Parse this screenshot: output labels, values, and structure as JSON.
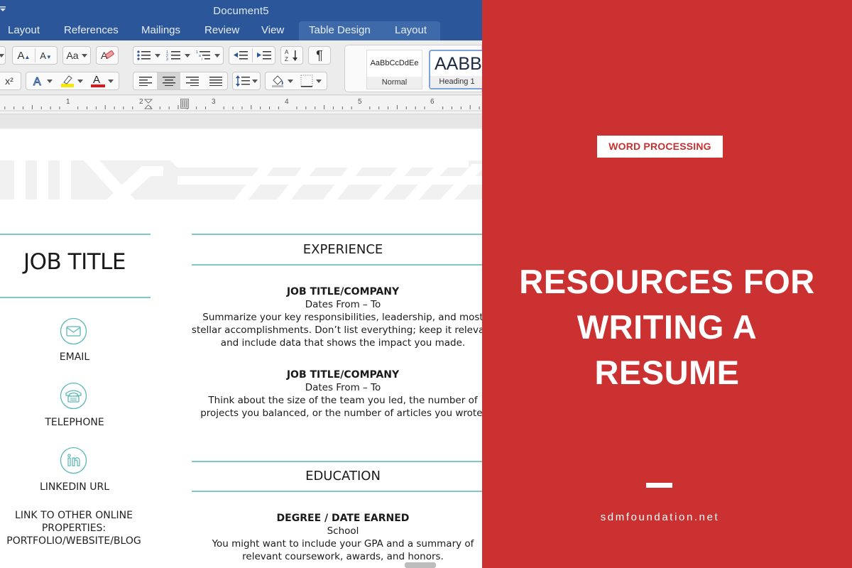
{
  "word": {
    "document_title": "Document5",
    "tabs": [
      "Layout",
      "References",
      "Mailings",
      "Review",
      "View",
      "Table Design",
      "Layout"
    ],
    "ribbon": {
      "superscript_label": "x²",
      "styles": [
        {
          "preview": "AaBbCcDdEe",
          "label": "Normal"
        },
        {
          "preview": "AABBC",
          "label": "Heading 1"
        }
      ]
    },
    "ruler_numbers": [
      "1",
      "2",
      "3",
      "4",
      "5",
      "6"
    ],
    "resume": {
      "job_title": "JOB TITLE",
      "contacts": [
        {
          "icon": "envelope-icon",
          "label": "EMAIL"
        },
        {
          "icon": "telephone-icon",
          "label": "TELEPHONE"
        },
        {
          "icon": "linkedin-icon",
          "label": "LINKEDIN URL"
        }
      ],
      "other_links": "LINK TO OTHER ONLINE PROPERTIES: PORTFOLIO/WEBSITE/BLOG",
      "experience_heading": "EXPERIENCE",
      "experience": [
        {
          "title": "JOB TITLE/COMPANY",
          "dates": "Dates From – To",
          "description": "Summarize your key responsibilities, leadership, and most stellar accomplishments. Don’t list everything; keep it relevant and include data that shows the impact you made."
        },
        {
          "title": "JOB TITLE/COMPANY",
          "dates": "Dates From – To",
          "description": "Think about the size of the team you led, the number of projects you balanced, or the number of articles you wrote."
        }
      ],
      "education_heading": "EDUCATION",
      "education": [
        {
          "title": "DEGREE / DATE EARNED",
          "school": "School",
          "description": "You might want to include your GPA and a summary of relevant coursework, awards, and honors."
        }
      ]
    }
  },
  "promo": {
    "badge": "WORD PROCESSING",
    "heading": "RESOURCES FOR WRITING A RESUME",
    "site": "sdmfoundation.net",
    "colors": {
      "background": "#cb3131",
      "text": "#ffffff"
    }
  }
}
